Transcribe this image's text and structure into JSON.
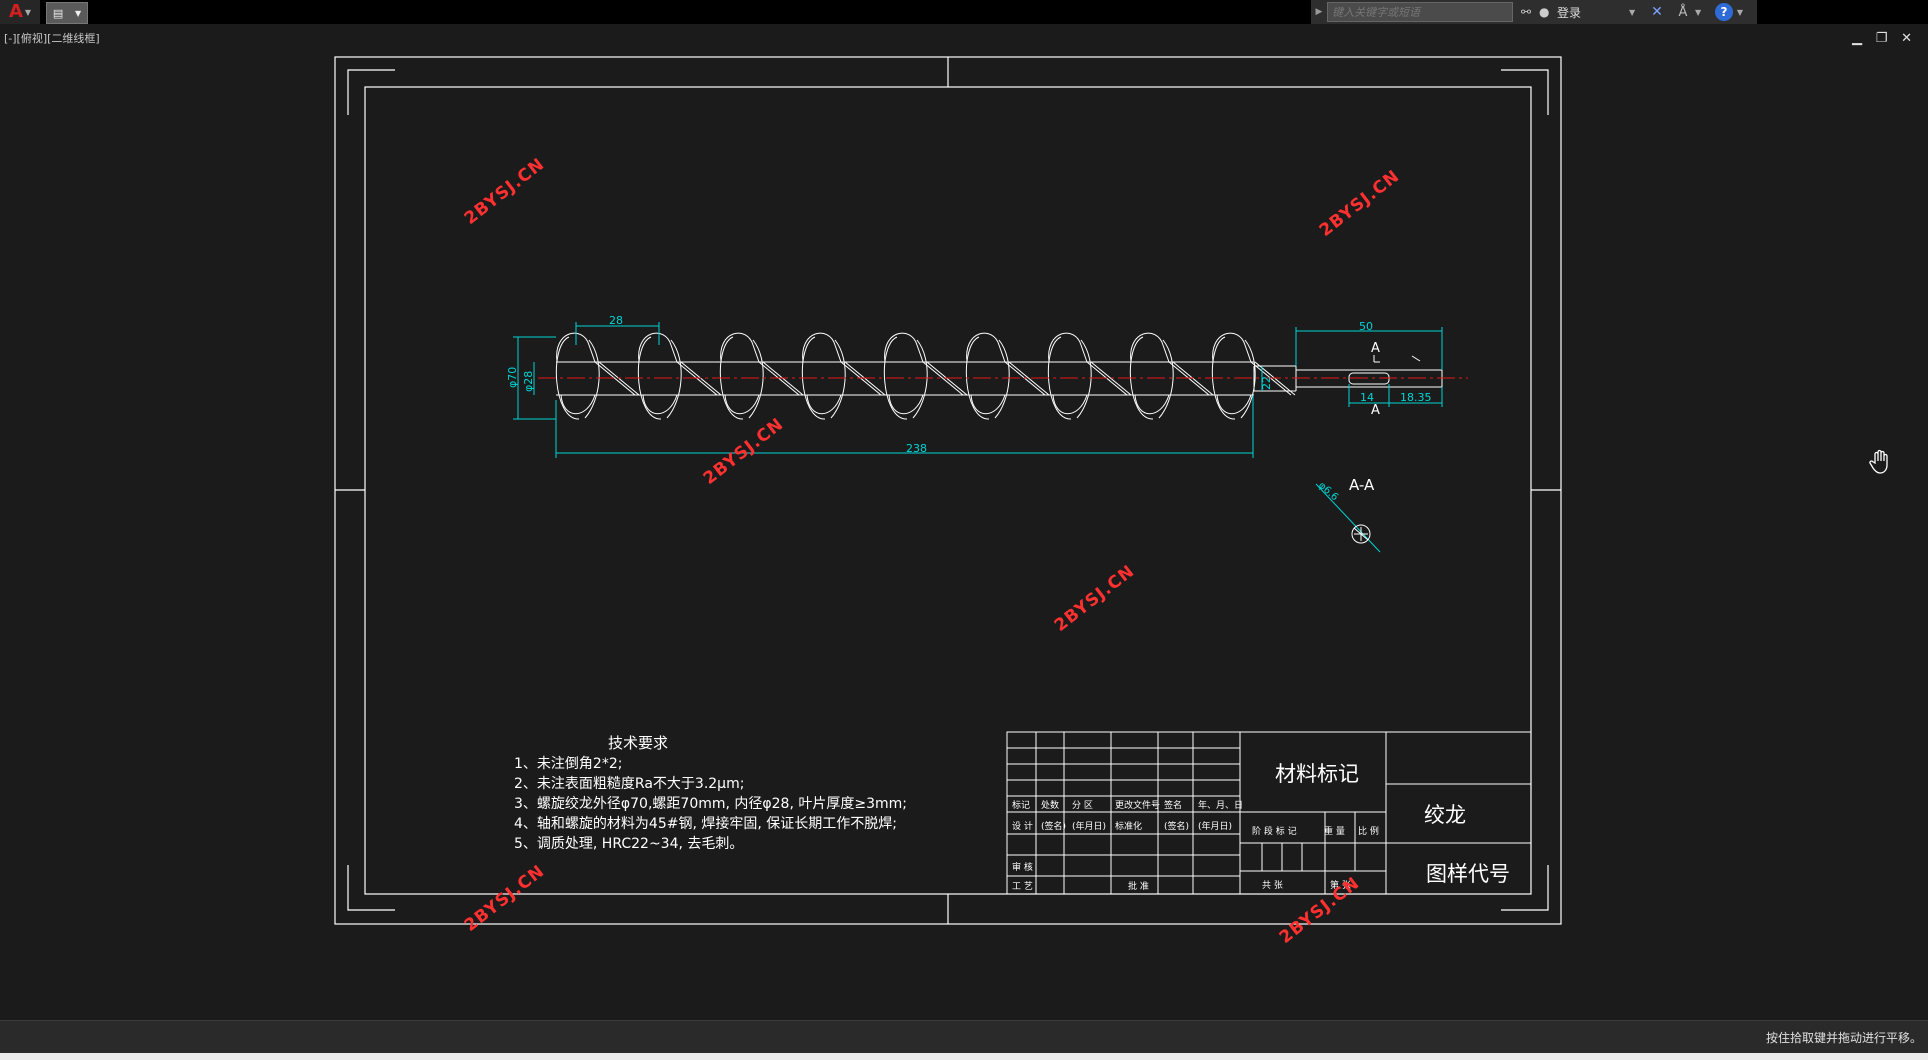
{
  "app": {
    "logo_glyph": "A",
    "logo_color": "#d02020"
  },
  "search": {
    "placeholder": "键入关键字或短语"
  },
  "user": {
    "login_label": "登录"
  },
  "viewport": {
    "label": "[-][俯视][二维线框]"
  },
  "status": {
    "message": "按住拾取键并拖动进行平移。"
  },
  "drawing": {
    "dims": {
      "pitch": "28",
      "outer_dia": "φ70",
      "inner_dia": "φ28",
      "length": "238",
      "shaft_len": "50",
      "key_len": "14",
      "key_pos": "18.35",
      "shaft_small": "22"
    },
    "section_mark": "A",
    "section_title": "A-A",
    "section_dim": "φ6.6",
    "tech_title": "技术要求",
    "tech_notes": [
      "1、未注倒角2*2;",
      "2、未注表面粗糙度Ra不大于3.2μm;",
      "3、螺旋绞龙外径φ70,螺距70mm, 内径φ28, 叶片厚度≥3mm;",
      "4、轴和螺旋的材料为45#钢, 焊接牢固, 保证长期工作不脱焊;",
      "5、调质处理, HRC22~34, 去毛刺。"
    ],
    "title_block": {
      "material_mark": "材料标记",
      "part_name": "绞龙",
      "drawing_code": "图样代号",
      "rev_headers": [
        "标记",
        "处数",
        "分 区",
        "更改文件号",
        "签名",
        "年、月、日"
      ],
      "design_row": [
        "设 计",
        "(签名)",
        "(年月日)",
        "标准化",
        "(签名)",
        "(年月日)"
      ],
      "review": "审 核",
      "process": "工 艺",
      "approve": "批 准",
      "stage_headers": [
        "阶 段 标 记",
        "重 量",
        "比 例"
      ],
      "total_sheets": "共   张",
      "sheet_no": "第   张"
    },
    "watermark": "2BYSJ.CN"
  },
  "colors": {
    "dim": "#00d5d5",
    "center": "#e01818",
    "line": "#ffffff",
    "watermark": "#ff3030"
  }
}
